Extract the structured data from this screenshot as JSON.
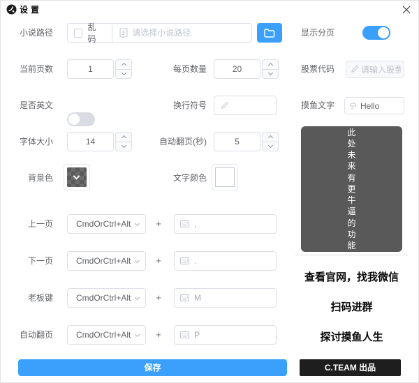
{
  "window": {
    "title": "设置",
    "close": "✕"
  },
  "form": {
    "novel_path": {
      "label": "小说路径",
      "garbled_label": "乱码",
      "placeholder": "请选择小说路径"
    },
    "show_pagination": {
      "label": "显示分页"
    },
    "current_page": {
      "label": "当前页数",
      "value": "1"
    },
    "page_size": {
      "label": "每页数量",
      "value": "20"
    },
    "stock_code": {
      "label": "股票代码",
      "placeholder": "请输入股票代码"
    },
    "is_english": {
      "label": "是否英文"
    },
    "newline_symbol": {
      "label": "换行符号",
      "value": ""
    },
    "fish_text": {
      "label": "摸鱼文字",
      "value": "Hello"
    },
    "font_size": {
      "label": "字体大小",
      "value": "14"
    },
    "auto_flip_seconds": {
      "label": "自动翻页(秒)",
      "value": "5"
    },
    "background_color": {
      "label": "背景色"
    },
    "text_color": {
      "label": "文字颜色"
    },
    "shortcuts": [
      {
        "label": "上一页",
        "modifier": "CmdOrCtrl+Alt",
        "plus": "+",
        "key": ","
      },
      {
        "label": "下一页",
        "modifier": "CmdOrCtrl+Alt",
        "plus": "+",
        "key": "."
      },
      {
        "label": "老板键",
        "modifier": "CmdOrCtrl+Alt",
        "plus": "+",
        "key": "M"
      },
      {
        "label": "自动翻页",
        "modifier": "CmdOrCtrl+Alt",
        "plus": "+",
        "key": "P"
      }
    ]
  },
  "promo": {
    "future_box": "此处未来有更牛逼的功能",
    "line1": "查看官网，找我微信",
    "line2": "扫码进群",
    "line3": "探讨摸鱼人生"
  },
  "footer": {
    "save_label": "保存",
    "brand_label": "C.TEAM 出品"
  },
  "colors": {
    "accent": "#3aa0fb",
    "dark_box": "#595959",
    "brand_bg": "#1e1e1e"
  }
}
